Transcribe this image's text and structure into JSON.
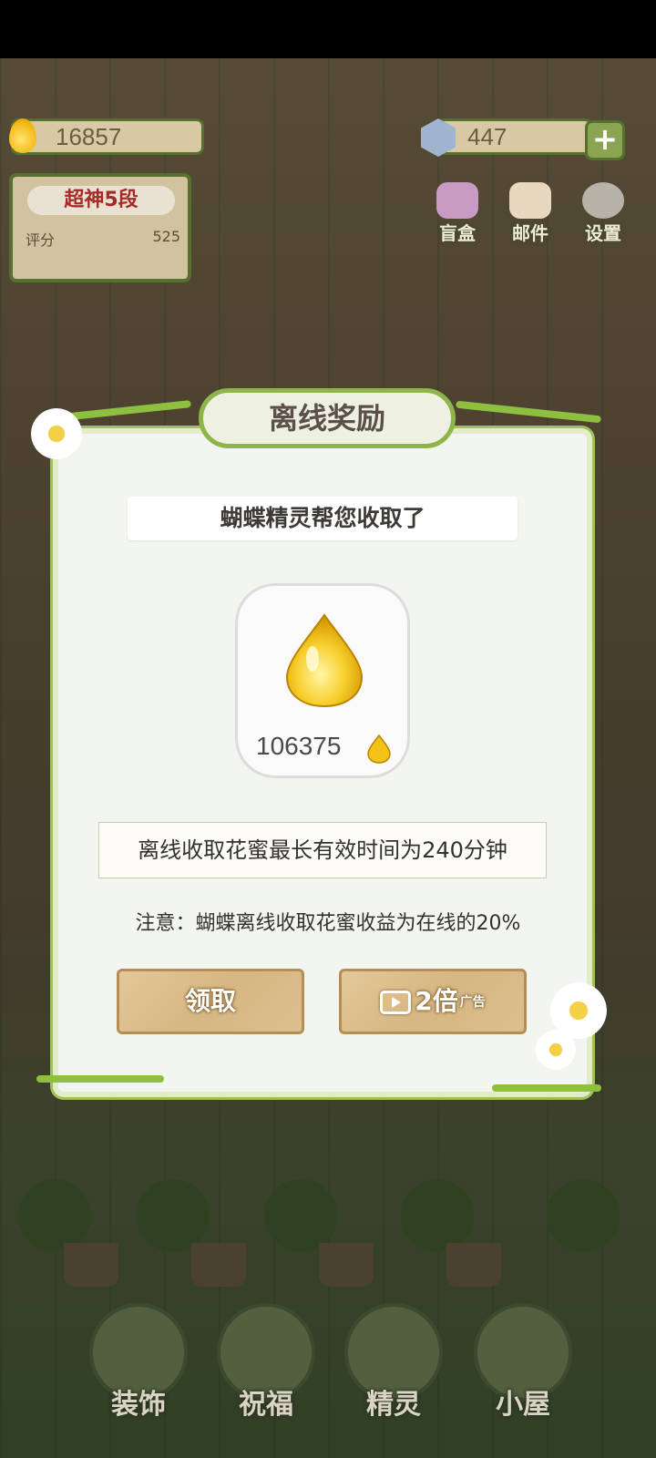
{
  "hud": {
    "honey_amount": "16857",
    "gem_amount": "447",
    "rank_title": "超神5段",
    "score_label": "评分",
    "score_value": "525"
  },
  "top_buttons": [
    {
      "label": "盲盒",
      "icon": "flower-box-icon"
    },
    {
      "label": "邮件",
      "icon": "mail-icon"
    },
    {
      "label": "设置",
      "icon": "gear-icon"
    }
  ],
  "dialog": {
    "title": "离线奖励",
    "subtitle": "蝴蝶精灵帮您收取了",
    "reward_amount": "106375",
    "max_time_note": "离线收取花蜜最长有效时间为240分钟",
    "notice": "注意：蝴蝶离线收取花蜜收益为在线的20%",
    "claim_label": "领取",
    "double_label": "2倍",
    "ad_label": "广告"
  },
  "bottom_nav": [
    {
      "label": "装饰",
      "icon": "plant-icon"
    },
    {
      "label": "祝福",
      "icon": "butterfly-icon"
    },
    {
      "label": "精灵",
      "icon": "fairy-icon"
    },
    {
      "label": "小屋",
      "icon": "house-icon"
    }
  ],
  "colors": {
    "frame_green": "#56702f",
    "honey_gold": "#f2b20c",
    "wood_button": "#d6b682",
    "rank_red": "#a52a28"
  }
}
